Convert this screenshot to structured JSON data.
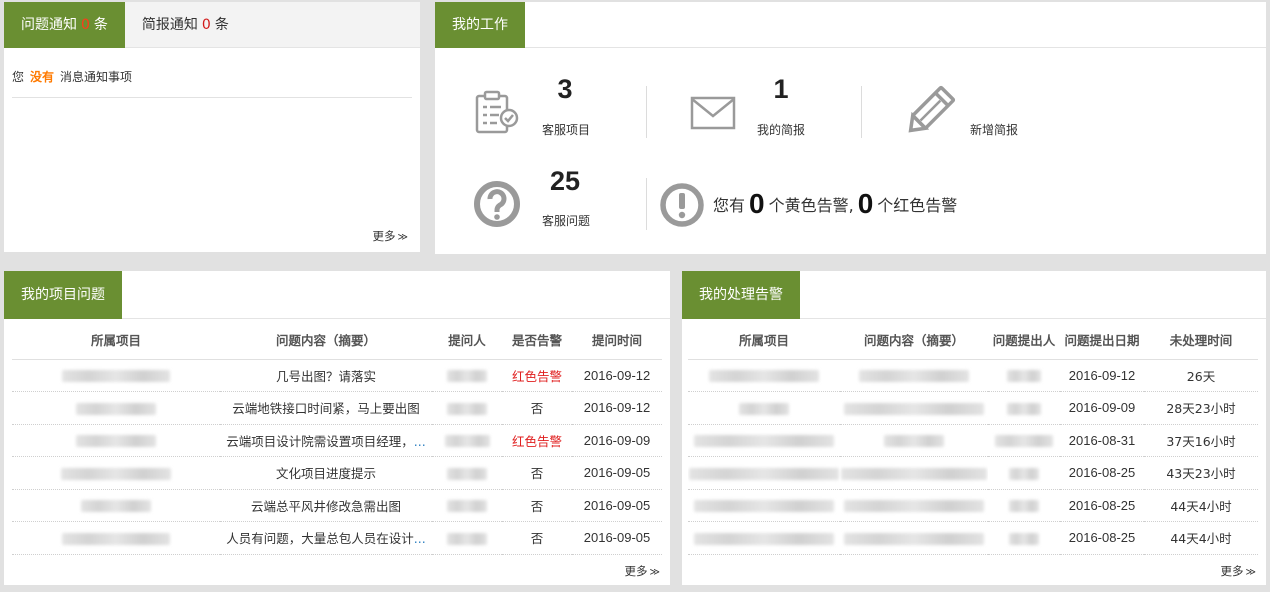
{
  "notice": {
    "tabs": [
      {
        "label": "问题通知",
        "count": "0",
        "unit": "条"
      },
      {
        "label": "简报通知",
        "count": "0",
        "unit": "条"
      }
    ],
    "message": {
      "prefix": "您",
      "highlight": "没有",
      "suffix": "消息通知事项"
    },
    "more": "更多",
    "more_arrow": "≫"
  },
  "work": {
    "title": "我的工作",
    "stats": [
      {
        "value": "3",
        "label": "客服项目",
        "icon": "clipboard-check-icon"
      },
      {
        "value": "1",
        "label": "我的简报",
        "icon": "envelope-icon"
      },
      {
        "label": "新增简报",
        "icon": "pencil-icon"
      },
      {
        "value": "25",
        "label": "客服问题",
        "icon": "question-circle-icon"
      }
    ],
    "warning": {
      "prefix": "您有",
      "yellow_count": "0",
      "yellow_label": "个黄色告警",
      "comma": ",",
      "red_count": "0",
      "red_label": "个红色告警",
      "icon": "exclamation-circle-icon"
    }
  },
  "projects": {
    "title": "我的项目问题",
    "headers": [
      "所属项目",
      "问题内容（摘要）",
      "提问人",
      "是否告警",
      "提问时间"
    ],
    "rows": [
      {
        "content": "几号出图？请落实",
        "alarm": "红色告警",
        "date": "2016-09-12"
      },
      {
        "content": "云端地铁接口时间紧，马上要出图",
        "alarm": "否",
        "date": "2016-09-12"
      },
      {
        "content": "云端项目设计院需设置项目经理，",
        "content_more": "...",
        "alarm": "红色告警",
        "date": "2016-09-09"
      },
      {
        "content": "文化项目进度提示",
        "alarm": "否",
        "date": "2016-09-05"
      },
      {
        "content": "云端总平风井修改急需出图",
        "alarm": "否",
        "date": "2016-09-05"
      },
      {
        "content": "人员有问题，大量总包人员在设计",
        "content_more": "...",
        "alarm": "否",
        "date": "2016-09-05"
      }
    ],
    "more": "更多",
    "more_arrow": "≫"
  },
  "alarms": {
    "title": "我的处理告警",
    "headers": [
      "所属项目",
      "问题内容（摘要）",
      "问题提出人",
      "问题提出日期",
      "未处理时间"
    ],
    "rows": [
      {
        "date": "2016-09-12",
        "elapsed": "26天"
      },
      {
        "date": "2016-09-09",
        "elapsed": "28天23小时"
      },
      {
        "date": "2016-08-31",
        "elapsed": "37天16小时"
      },
      {
        "date": "2016-08-25",
        "elapsed": "43天23小时"
      },
      {
        "date": "2016-08-25",
        "elapsed": "44天4小时"
      },
      {
        "date": "2016-08-25",
        "elapsed": "44天4小时"
      }
    ],
    "more": "更多",
    "more_arrow": "≫"
  },
  "colors": {
    "accent_green": "#6a8f32",
    "alarm_red": "#e02020",
    "highlight_orange": "#ff7a00"
  }
}
